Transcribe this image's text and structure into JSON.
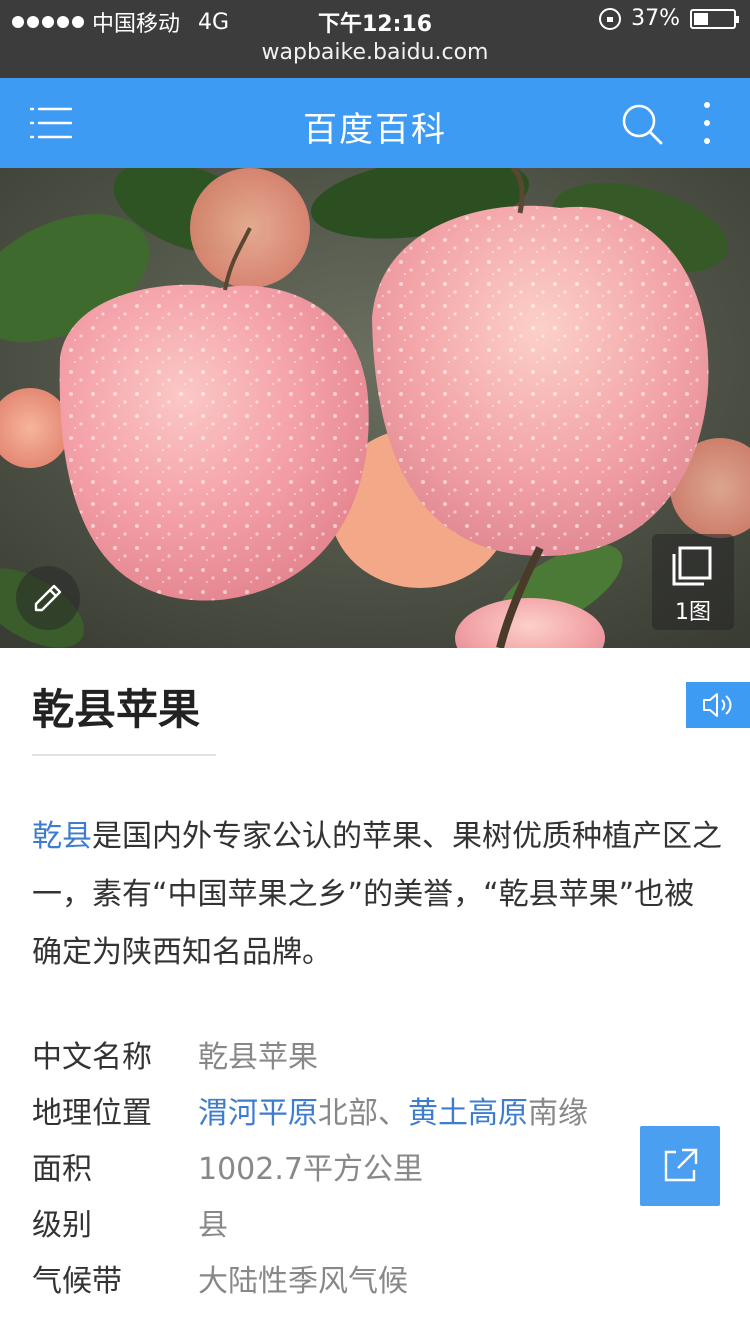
{
  "status_bar": {
    "carrier": "中国移动",
    "network": "4G",
    "time": "下午12:16",
    "battery_percent": "37%",
    "battery_level": 0.37,
    "url": "wapbaike.baidu.com"
  },
  "header": {
    "title": "百度百科",
    "icons": [
      "menu-icon",
      "search-icon",
      "more-icon"
    ]
  },
  "hero": {
    "gallery_count": "1图",
    "icons": [
      "edit-icon",
      "gallery-icon"
    ]
  },
  "article": {
    "title": "乾县苹果",
    "summary": {
      "link_text": "乾县",
      "text": "是国内外专家公认的苹果、果树优质种植产区之一，素有“中国苹果之乡”的美誉，“乾县苹果”也被确定为陕西知名品牌。"
    },
    "info": [
      {
        "key": "中文名称",
        "value": "乾县苹果"
      },
      {
        "key": "地理位置",
        "link1": "渭河平原",
        "text1": "北部、",
        "link2": "黄土高原",
        "text2": "南缘"
      },
      {
        "key": "面积",
        "value": "1002.7平方公里"
      },
      {
        "key": "级别",
        "value": "县"
      },
      {
        "key": "气候带",
        "value": "大陆性季风气候"
      }
    ]
  },
  "colors": {
    "header_bg": "#3d9bf4",
    "status_bg": "#3c3c3c",
    "link": "#3d7ccf"
  }
}
